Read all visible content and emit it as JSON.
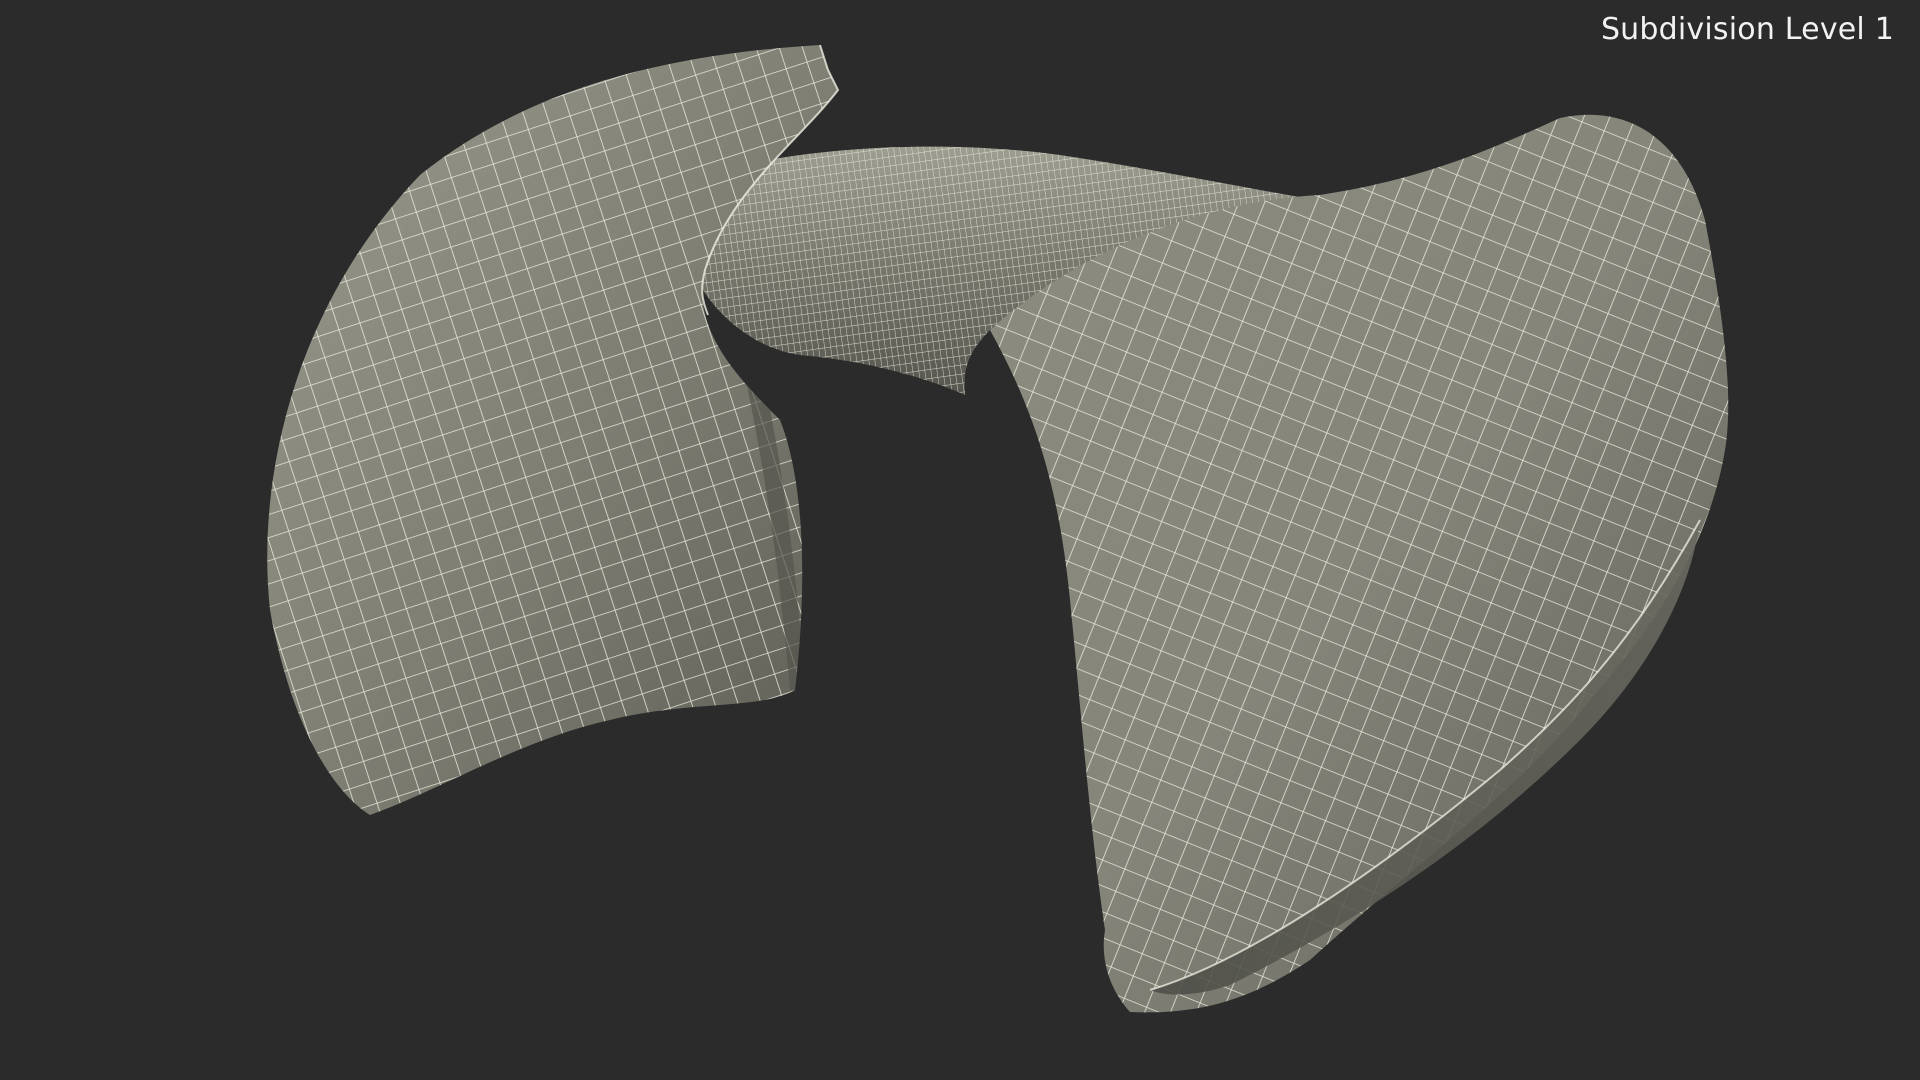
{
  "overlay": {
    "label": "Subdivision Level 1"
  },
  "colors": {
    "background": "#2b2b2b",
    "surface": "#8a8a7e",
    "surface_shadow": "#5f5f56",
    "surface_highlight": "#a4a497",
    "wireframe": "#f2f2e8"
  }
}
